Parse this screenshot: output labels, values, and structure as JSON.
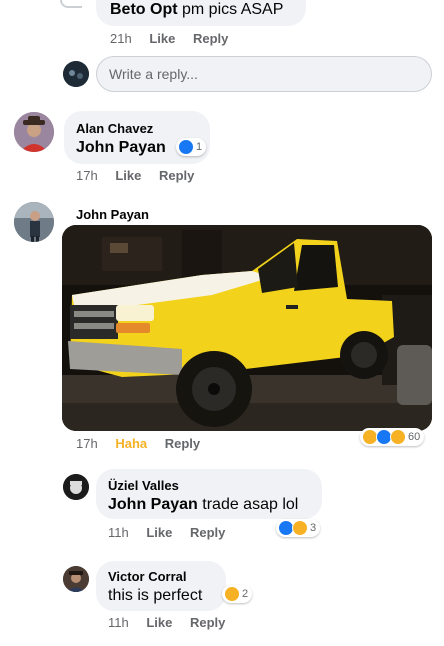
{
  "comments": [
    {
      "author": "Beto Opt",
      "text": "pm pics ASAP",
      "time": "21h",
      "like_label": "Like",
      "reply_label": "Reply"
    },
    {
      "author": "Alan Chavez",
      "tagged": "John Payan",
      "time": "17h",
      "like_label": "Like",
      "reply_label": "Reply",
      "reaction_count": "1"
    },
    {
      "author": "John Payan",
      "time": "17h",
      "reacted_label": "Haha",
      "reply_label": "Reply",
      "reaction_count": "60"
    },
    {
      "author": "Üziel Valles",
      "tagged": "John Payan",
      "text": "trade asap lol",
      "time": "11h",
      "like_label": "Like",
      "reply_label": "Reply",
      "reaction_count": "3"
    },
    {
      "author": "Victor Corral",
      "text": "this is perfect",
      "time": "11h",
      "like_label": "Like",
      "reply_label": "Reply",
      "reaction_count": "2"
    }
  ],
  "reply_box": {
    "placeholder": "Write a reply..."
  },
  "colors": {
    "bubble": "#f0f2f5",
    "like_blue": "#1877f2",
    "haha_yellow": "#f7b125",
    "meta_gray": "#65676b"
  }
}
